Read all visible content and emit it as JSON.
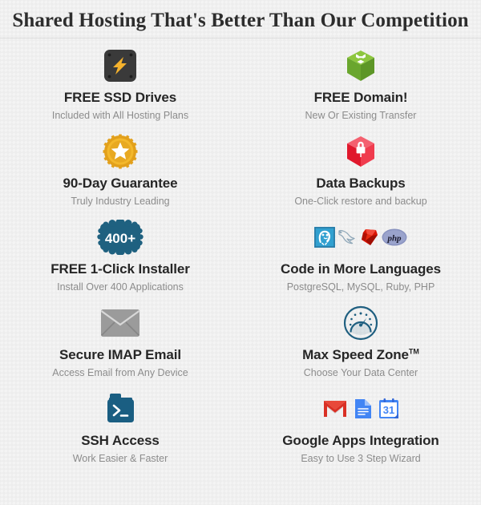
{
  "header": {
    "title": "Shared Hosting That's Better Than Our Competition"
  },
  "colors": {
    "title_text": "#2d2d2d",
    "feature_title_text": "#262626",
    "feature_sub_text": "#8c8c8c",
    "background": "#f4f4f4",
    "ssd_icon_body": "#3a3a3a",
    "ssd_icon_bolt": "#f5b22d",
    "domain_box_green": "#76bc43",
    "guarantee_gold": "#e8a922",
    "backup_red": "#e8273c",
    "installer_teal": "#1f6180",
    "email_grey": "#9b9b9b",
    "speed_blue": "#1f5f80",
    "ssh_blue": "#1a5e82",
    "gmail_red": "#d93025",
    "gdocs_blue": "#4285f4",
    "gcal_blue": "#4285f4",
    "postgres_blue": "#31648c",
    "ruby_red": "#d91404",
    "php_purple": "#8892bf"
  },
  "features": [
    {
      "icon": "ssd-drive-icon",
      "title": "FREE SSD Drives",
      "subtitle": "Included with All Hosting Plans"
    },
    {
      "icon": "domain-box-icon",
      "title": "FREE Domain!",
      "subtitle": "New Or Existing Transfer"
    },
    {
      "icon": "guarantee-badge-icon",
      "title": "90-Day Guarantee",
      "subtitle": "Truly Industry Leading"
    },
    {
      "icon": "data-backup-lock-icon",
      "title": "Data Backups",
      "subtitle": "One-Click restore and backup"
    },
    {
      "icon": "four-hundred-plus-badge-icon",
      "title": "FREE 1-Click Installer",
      "subtitle": "Install Over 400 Applications",
      "badge_text": "400+"
    },
    {
      "icon": "programming-languages-icon",
      "title": "Code in More Languages",
      "subtitle": "PostgreSQL, MySQL, Ruby, PHP",
      "logos": [
        "postgresql-logo",
        "mysql-dolphin-logo",
        "ruby-gem-logo",
        "php-logo"
      ],
      "php_label": "php"
    },
    {
      "icon": "envelope-icon",
      "title": "Secure IMAP Email",
      "subtitle": "Access Email from Any Device"
    },
    {
      "icon": "speedometer-icon",
      "title": "Max Speed Zone",
      "title_suffix": "TM",
      "subtitle": "Choose Your Data Center"
    },
    {
      "icon": "ssh-terminal-icon",
      "title": "SSH Access",
      "subtitle": "Work Easier & Faster"
    },
    {
      "icon": "google-apps-icon",
      "title": "Google Apps Integration",
      "subtitle": "Easy to Use 3 Step Wizard",
      "logos": [
        "gmail-logo",
        "google-docs-logo",
        "google-calendar-logo"
      ],
      "calendar_day": "31"
    }
  ]
}
